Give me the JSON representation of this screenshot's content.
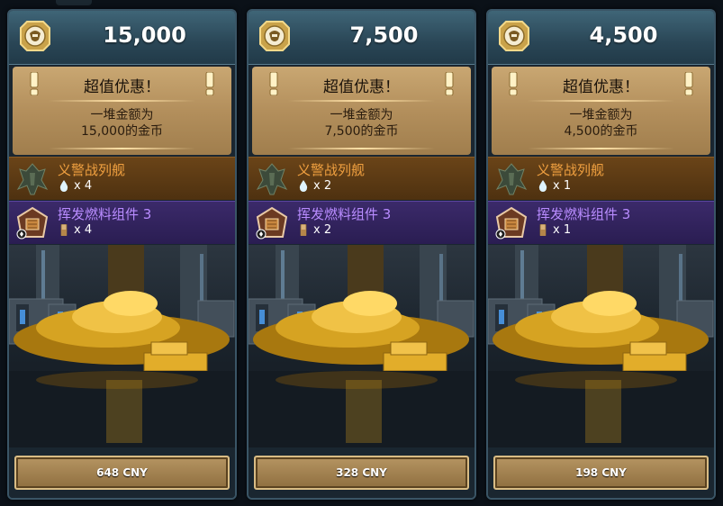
{
  "colors": {
    "header": "#2a4656",
    "promo_bg": "#b38f5c",
    "ship_row": "#4e3110",
    "part_row": "#2a1d52",
    "ship_name": "#f0a040",
    "part_name": "#b98cff",
    "button": "#a8864f"
  },
  "cards": [
    {
      "coins": "15,000",
      "promo_title": "超值优惠！",
      "promo_line1": "一堆金额为",
      "promo_line2": "15,000的金币",
      "ship_name": "义警战列舰",
      "ship_qty": "x 4",
      "part_name": "挥发燃料组件 3",
      "part_qty": "x 4",
      "price": "648 CNY"
    },
    {
      "coins": "7,500",
      "promo_title": "超值优惠！",
      "promo_line1": "一堆金额为",
      "promo_line2": "7,500的金币",
      "ship_name": "义警战列舰",
      "ship_qty": "x 2",
      "part_name": "挥发燃料组件 3",
      "part_qty": "x 2",
      "price": "328 CNY"
    },
    {
      "coins": "4,500",
      "promo_title": "超值优惠！",
      "promo_line1": "一堆金额为",
      "promo_line2": "4,500的金币",
      "ship_name": "义警战列舰",
      "ship_qty": "x 1",
      "part_name": "挥发燃料组件 3",
      "part_qty": "x 1",
      "price": "198 CNY"
    }
  ],
  "icons": {
    "coin": "coin-icon",
    "exclamation": "exclamation-icon",
    "ship": "battleship-icon",
    "part": "fuel-component-icon",
    "ship_qty": "droplet-icon",
    "part_qty": "vial-icon"
  }
}
